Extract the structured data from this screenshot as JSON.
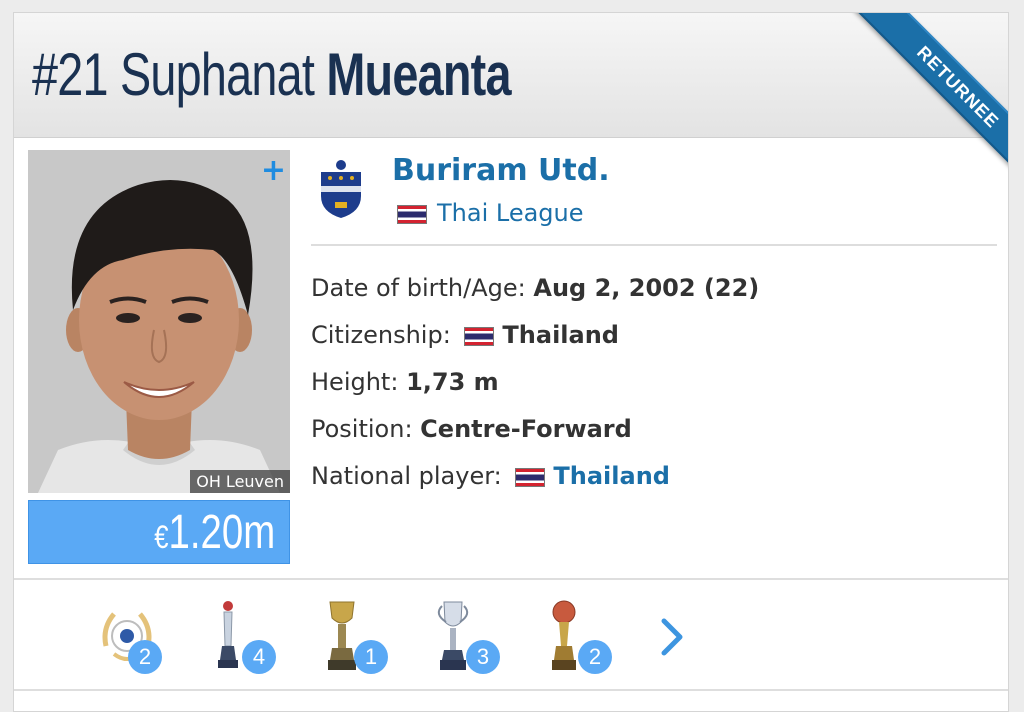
{
  "header": {
    "number": "#21",
    "first_name": "Suphanat",
    "last_name": "Mueanta",
    "ribbon": "RETURNEE"
  },
  "photo": {
    "caption": "OH Leuven",
    "plus": "+"
  },
  "market_value": {
    "currency": "€",
    "amount": "1.20m"
  },
  "club": {
    "name": "Buriram Utd.",
    "league": "Thai League"
  },
  "info": {
    "dob_label": "Date of birth/Age:",
    "dob_value": "Aug 2, 2002 (22)",
    "citizenship_label": "Citizenship:",
    "citizenship_value": "Thailand",
    "height_label": "Height:",
    "height_value": "1,73 m",
    "position_label": "Position:",
    "position_value": "Centre-Forward",
    "national_label": "National player:",
    "national_value": "Thailand"
  },
  "trophies": [
    {
      "icon": "laurel-award-icon",
      "count": "2"
    },
    {
      "icon": "silver-trophy-icon",
      "count": "4"
    },
    {
      "icon": "gold-cup-icon",
      "count": "1"
    },
    {
      "icon": "silver-cup-icon",
      "count": "3"
    },
    {
      "icon": "gold-ball-trophy-icon",
      "count": "2"
    }
  ],
  "colors": {
    "accent": "#1b6fa8",
    "market_value_bg": "#5aa9f5",
    "title": "#1a3151"
  }
}
